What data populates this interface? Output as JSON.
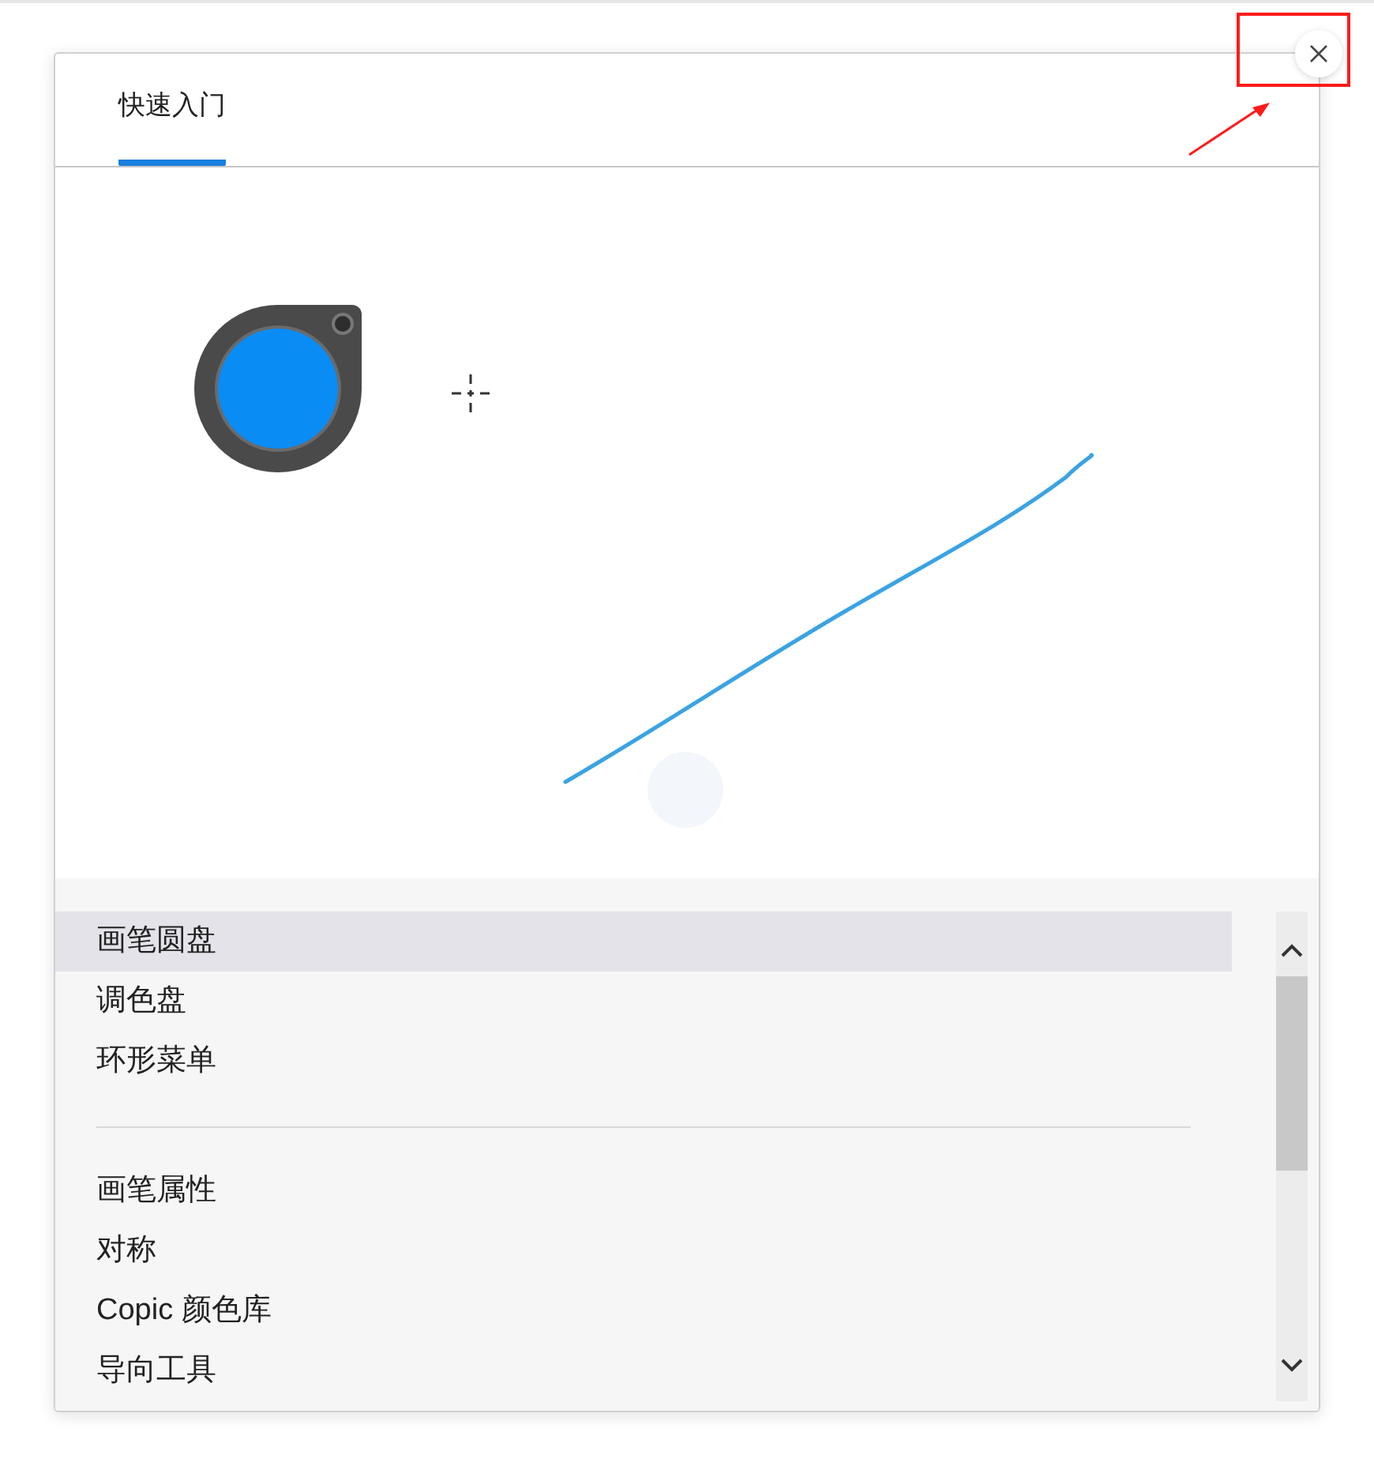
{
  "tabs": [
    {
      "label": "快速入门",
      "selected": true
    }
  ],
  "menu_groups": [
    {
      "items": [
        {
          "label": "画笔圆盘",
          "selected": true
        },
        {
          "label": "调色盘",
          "selected": false
        },
        {
          "label": "环形菜单",
          "selected": false
        }
      ]
    },
    {
      "items": [
        {
          "label": "画笔属性",
          "selected": false
        },
        {
          "label": "对称",
          "selected": false
        },
        {
          "label": "Copic 颜色库",
          "selected": false
        },
        {
          "label": "导向工具",
          "selected": false
        }
      ]
    }
  ]
}
